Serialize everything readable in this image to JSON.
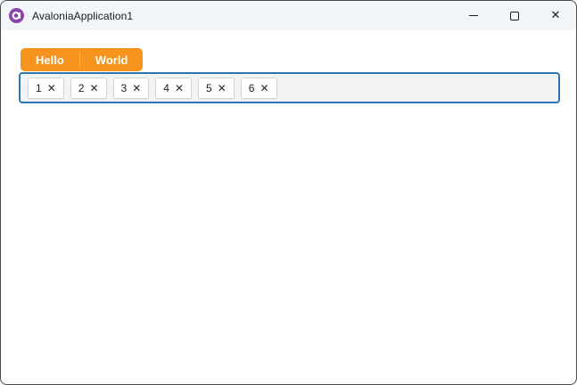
{
  "window": {
    "title": "AvaloniaApplication1",
    "logo_color": "#8B44AC",
    "icons": {
      "app": "avalonia-logo",
      "minimize": "minimize-icon",
      "maximize": "maximize-icon",
      "close": "close-icon",
      "close_glyph": "✕"
    }
  },
  "tabs": {
    "accent_color": "#F7941D",
    "items": [
      {
        "label": "Hello"
      },
      {
        "label": "World"
      }
    ]
  },
  "chips": {
    "border_color": "#2E75B6",
    "background": "#F1F3F4",
    "remove_glyph": "✕",
    "items": [
      {
        "label": "1"
      },
      {
        "label": "2"
      },
      {
        "label": "3"
      },
      {
        "label": "4"
      },
      {
        "label": "5"
      },
      {
        "label": "6"
      }
    ]
  }
}
